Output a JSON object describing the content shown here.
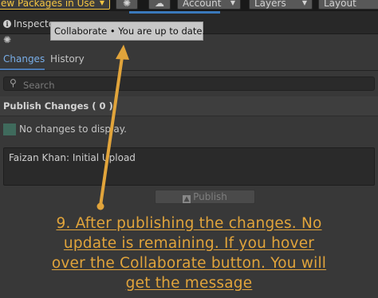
{
  "toolbar": {
    "packages_label": "ew Packages in Use",
    "account_label": "Account",
    "layers_label": "Layers",
    "layout_label": "Layout"
  },
  "inspector": {
    "tab_label": "Inspecto"
  },
  "tooltip": {
    "text": "Collaborate • You are up to date."
  },
  "collab": {
    "tabs": [
      "Changes",
      "History"
    ],
    "search_placeholder": "Search",
    "publish_header": "Publish Changes ( 0 )",
    "no_changes_text": "No changes to display.",
    "commit_message": "Faizan Khan: Initial Upload",
    "publish_button": "Publish"
  },
  "annotation": {
    "lines": [
      "9. After publishing the changes. No",
      "update is remaining. If you hover",
      "over the Collaborate button. You will",
      "get the message"
    ],
    "color": "#e1a43b"
  }
}
